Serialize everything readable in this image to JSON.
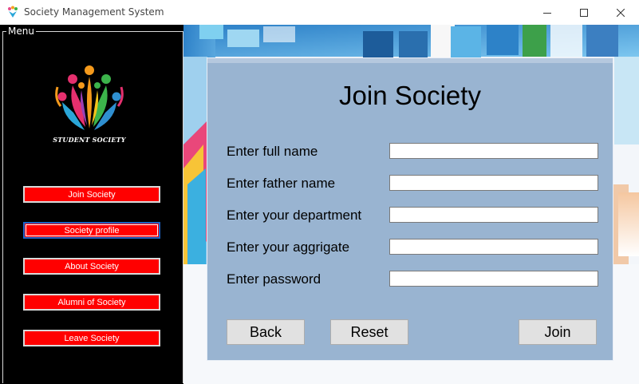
{
  "window": {
    "title": "Society Management System",
    "minimize_icon": "minimize-icon",
    "maximize_icon": "maximize-icon",
    "close_icon": "close-icon"
  },
  "menu": {
    "legend": "Menu",
    "logo_text": "STUDENT SOCIETY",
    "items": [
      {
        "label": "Join Society",
        "active": false
      },
      {
        "label": "Society profile",
        "active": true
      },
      {
        "label": "About Society",
        "active": false
      },
      {
        "label": "Alumni of Society",
        "active": false
      },
      {
        "label": "Leave Society",
        "active": false
      }
    ],
    "button_color": "#ff0000"
  },
  "form": {
    "title": "Join Society",
    "background_color": "#99b4d1",
    "fields": [
      {
        "label": "Enter full name",
        "value": ""
      },
      {
        "label": "Enter father name",
        "value": ""
      },
      {
        "label": "Enter your department",
        "value": ""
      },
      {
        "label": "Enter your aggrigate",
        "value": ""
      },
      {
        "label": "Enter password",
        "value": ""
      }
    ],
    "buttons": {
      "back": "Back",
      "reset": "Reset",
      "join": "Join"
    }
  }
}
